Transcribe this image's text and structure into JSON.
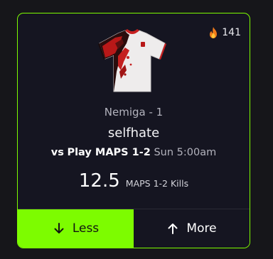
{
  "popularity": {
    "count": "141",
    "icon": "fire-icon"
  },
  "player": {
    "team_line": "Nemiga - 1",
    "name": "selfhate",
    "jersey_icon": "jersey-image"
  },
  "match": {
    "vs": "vs",
    "opponent": "Play MAPS 1-2",
    "time": "Sun 5:00am"
  },
  "projection": {
    "value": "12.5",
    "label": "MAPS 1-2 Kills"
  },
  "actions": {
    "less_label": "Less",
    "more_label": "More"
  },
  "colors": {
    "accent": "#7dfc00",
    "card_bg": "#151521",
    "page_bg": "#16161a"
  }
}
